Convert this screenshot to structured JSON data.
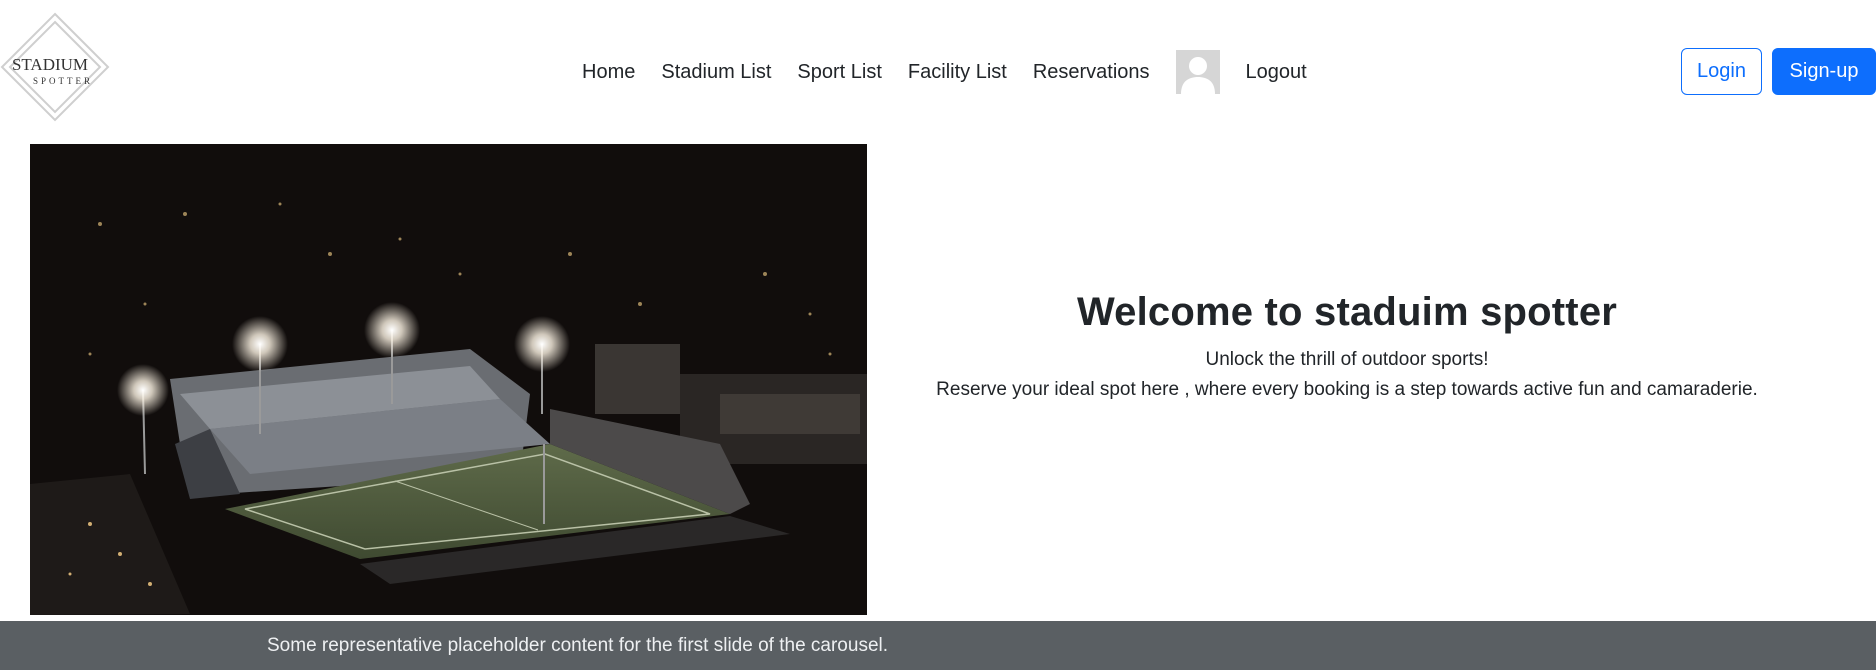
{
  "brand": {
    "logo_text_main": "STADIUM",
    "logo_text_sub": "SPOTTER"
  },
  "nav": {
    "items": [
      {
        "label": "Home"
      },
      {
        "label": "Stadium List"
      },
      {
        "label": "Sport List"
      },
      {
        "label": "Facility List"
      },
      {
        "label": "Reservations"
      }
    ],
    "avatar_icon": "user-silhouette-icon",
    "logout_label": "Logout"
  },
  "auth": {
    "login_label": "Login",
    "signup_label": "Sign-up"
  },
  "hero": {
    "title": "Welcome to staduim spotter",
    "line1": "Unlock the thrill of outdoor sports!",
    "line2": "Reserve your ideal spot here , where every booking is a step towards active fun and camaraderie."
  },
  "carousel": {
    "caption": "Some representative placeholder content for the first slide of the carousel."
  },
  "colors": {
    "primary": "#0d6efd",
    "caption_bg": "#5a5f63",
    "text": "#212529"
  }
}
